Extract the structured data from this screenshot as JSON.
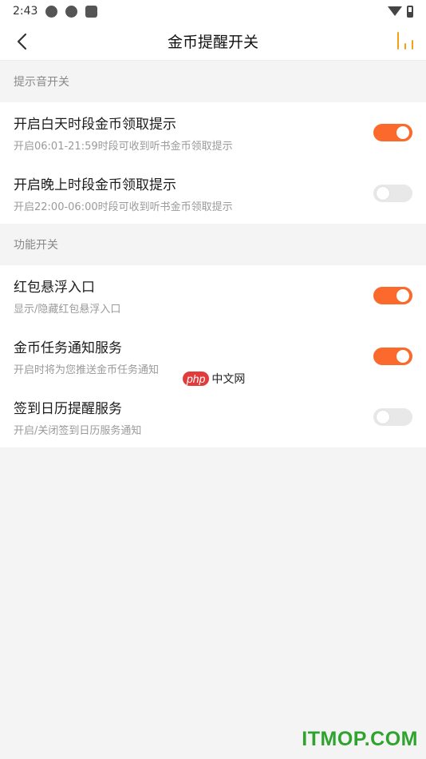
{
  "status_bar": {
    "time": "2:43",
    "left_icons": [
      "android-icon",
      "sync-icon",
      "a-badge-icon"
    ],
    "right_icons": [
      "wifi-icon",
      "battery-icon"
    ]
  },
  "nav": {
    "title": "金币提醒开关",
    "back_icon": "chevron-left-icon",
    "right_icon": "bar-chart-icon",
    "accent_color": "#f5a012"
  },
  "sections": [
    {
      "header": "提示音开关",
      "items": [
        {
          "title": "开启白天时段金币领取提示",
          "subtitle": "开启06:01-21:59时段可收到听书金币领取提示",
          "on": true
        },
        {
          "title": "开启晚上时段金币领取提示",
          "subtitle": "开启22:00-06:00时段可收到听书金币领取提示",
          "on": false
        }
      ]
    },
    {
      "header": "功能开关",
      "items": [
        {
          "title": "红包悬浮入口",
          "subtitle": "显示/隐藏红包悬浮入口",
          "on": true
        },
        {
          "title": "金币任务通知服务",
          "subtitle": "开启时将为您推送金币任务通知",
          "on": true
        },
        {
          "title": "签到日历提醒服务",
          "subtitle": "开启/关闭签到日历服务通知",
          "on": false
        }
      ]
    }
  ],
  "colors": {
    "toggle_on": "#fb6a2c",
    "toggle_off": "#e8e8e8",
    "background": "#f4f4f4"
  },
  "watermarks": {
    "php_badge": "php",
    "php_text": "中文网",
    "itmop": "ITMOP.COM"
  }
}
